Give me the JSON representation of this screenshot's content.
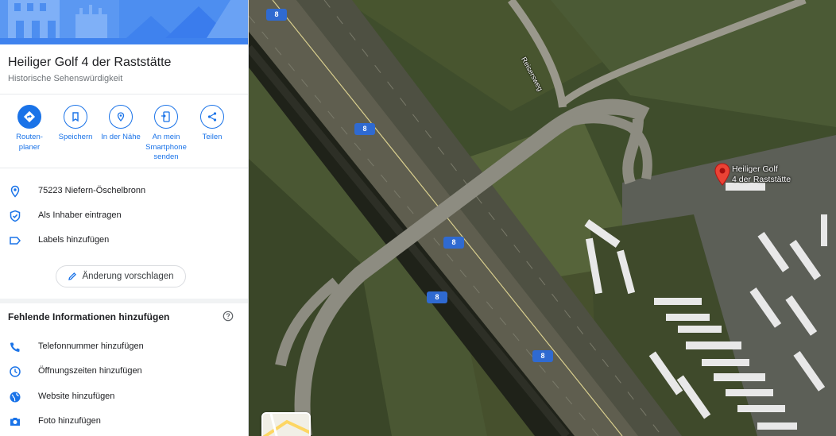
{
  "place": {
    "title": "Heiliger Golf 4 der Raststätte",
    "category": "Historische Sehenswürdigkeit"
  },
  "actions": [
    {
      "label": "Routen-\nplaner",
      "icon": "directions-icon"
    },
    {
      "label": "Speichern",
      "icon": "bookmark-icon"
    },
    {
      "label": "In der Nähe",
      "icon": "nearby-icon"
    },
    {
      "label": "An mein\nSmartphone\nsenden",
      "icon": "phone-icon"
    },
    {
      "label": "Teilen",
      "icon": "share-icon"
    }
  ],
  "info": {
    "address": "75223 Niefern-Öschelbronn",
    "claim": "Als Inhaber eintragen",
    "labels": "Labels hinzufügen"
  },
  "suggest_edit": "Änderung vorschlagen",
  "missing": {
    "title": "Fehlende Informationen hinzufügen",
    "items": [
      {
        "label": "Telefonnummer hinzufügen",
        "icon": "phone-call-icon"
      },
      {
        "label": "Öffnungszeiten hinzufügen",
        "icon": "clock-icon"
      },
      {
        "label": "Website hinzufügen",
        "icon": "globe-icon"
      },
      {
        "label": "Foto hinzufügen",
        "icon": "camera-icon"
      }
    ]
  },
  "map": {
    "pin_label": "Heiliger Golf\n4 der Raststätte",
    "street": "Reisersweg",
    "road_shields": [
      "8",
      "8",
      "8",
      "8",
      "8"
    ]
  },
  "colors": {
    "accent": "#1a73e8",
    "pin": "#ea4335",
    "shield": "#2f6ad1"
  }
}
